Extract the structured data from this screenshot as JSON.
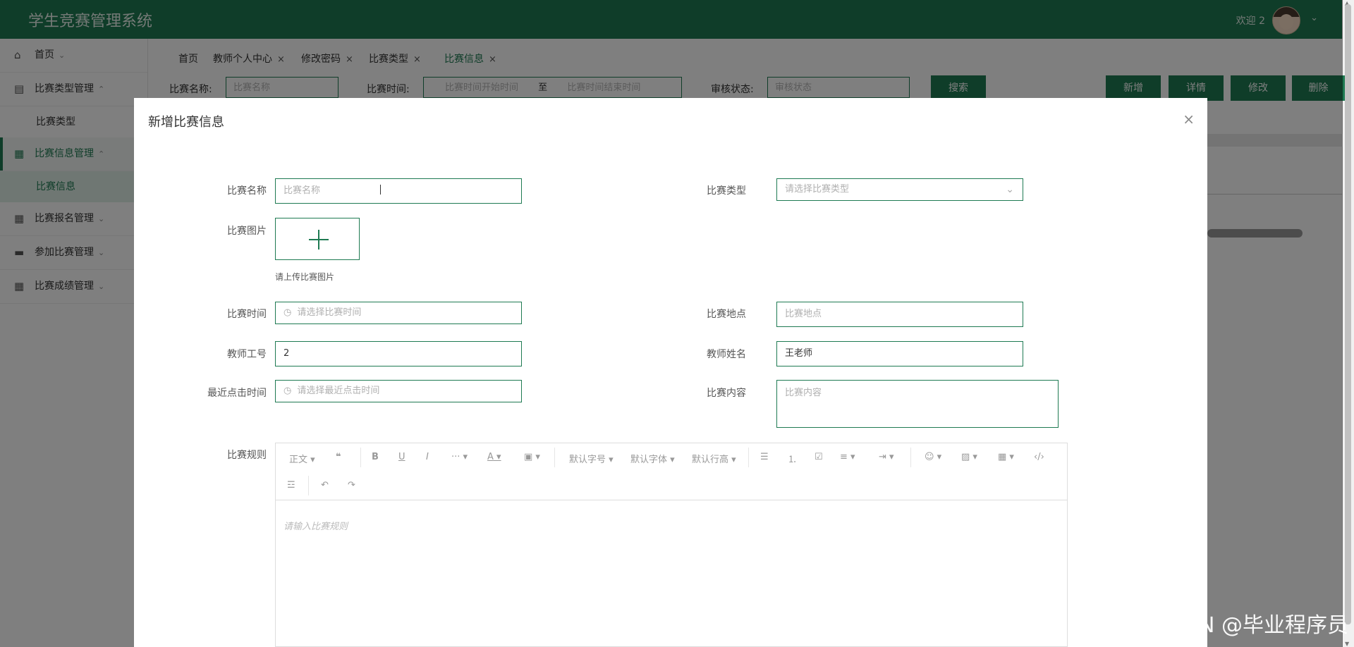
{
  "app_title": "学生竞赛管理系统",
  "user": {
    "welcome": "欢迎 2",
    "menu_chevron": "⌄"
  },
  "sidebar": {
    "home": "首页",
    "groups": [
      {
        "label": "比赛类型管理",
        "sub": "比赛类型"
      },
      {
        "label": "比赛信息管理",
        "sub": "比赛信息"
      },
      {
        "label": "比赛报名管理"
      },
      {
        "label": "参加比赛管理"
      },
      {
        "label": "比赛成绩管理"
      }
    ]
  },
  "tabs": [
    {
      "label": "首页"
    },
    {
      "label": "教师个人中心",
      "close": "×"
    },
    {
      "label": "修改密码",
      "close": "×"
    },
    {
      "label": "比赛类型",
      "close": "×"
    },
    {
      "label": "比赛信息",
      "close": "×"
    }
  ],
  "search": {
    "name_label": "比赛名称:",
    "name_placeholder": "比赛名称",
    "time_label": "比赛时间:",
    "time_start_placeholder": "比赛时间开始时间",
    "time_to": "至",
    "time_end_placeholder": "比赛时间结束时间",
    "status_label": "审核状态:",
    "status_placeholder": "审核状态",
    "search_button": "搜索"
  },
  "actions": {
    "add": "新增",
    "detail": "详情",
    "edit": "修改",
    "delete": "删除"
  },
  "dialog": {
    "title": "新增比赛信息",
    "close": "×",
    "fields": {
      "name": {
        "label": "比赛名称",
        "placeholder": "比赛名称"
      },
      "type": {
        "label": "比赛类型",
        "placeholder": "请选择比赛类型"
      },
      "image": {
        "label": "比赛图片",
        "tip": "请上传比赛图片"
      },
      "time": {
        "label": "比赛时间",
        "placeholder": "请选择比赛时间"
      },
      "location": {
        "label": "比赛地点",
        "placeholder": "比赛地点"
      },
      "teacher_id": {
        "label": "教师工号",
        "value": "2"
      },
      "teacher_name": {
        "label": "教师姓名",
        "value": "王老师"
      },
      "last_click": {
        "label": "最近点击时间",
        "placeholder": "请选择最近点击时间"
      },
      "content": {
        "label": "比赛内容",
        "placeholder": "比赛内容"
      },
      "rules": {
        "label": "比赛规则",
        "placeholder": "请输入比赛规则"
      }
    },
    "editor_toolbar": {
      "paragraph": "正文",
      "font_size": "默认字号",
      "font_family": "默认字体",
      "line_height": "默认行高"
    }
  },
  "watermark": "CSDN @毕业程序员",
  "colors": {
    "primary": "#1e7a52",
    "overlay": "rgba(0,0,0,0.5)"
  }
}
